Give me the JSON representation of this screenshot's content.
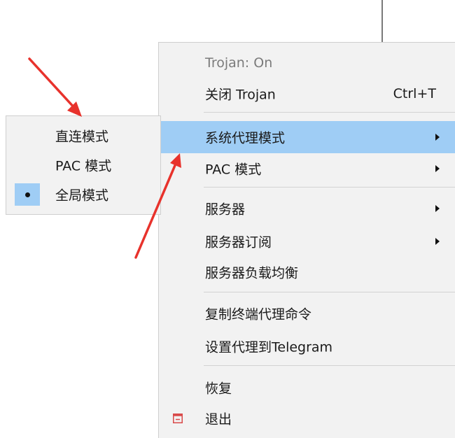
{
  "colors": {
    "menu_background": "#f2f2f2",
    "highlight": "#9fcdf5",
    "disabled_text": "#7b7b7b",
    "annotation_arrow": "#e8322c",
    "exit_icon": "#d94b4b"
  },
  "menu": {
    "status_label": "Trojan: On",
    "close_label": "关闭 Trojan",
    "close_shortcut": "Ctrl+T",
    "system_proxy_label": "系统代理模式",
    "pac_label": "PAC 模式",
    "servers_label": "服务器",
    "subscription_label": "服务器订阅",
    "load_balance_label": "服务器负载均衡",
    "copy_command_label": "复制终端代理命令",
    "telegram_label": "设置代理到Telegram",
    "restore_label": "恢复",
    "exit_label": "退出",
    "exit_icon": "window-minimize-icon",
    "submenu_arrow_icon": "chevron-right-icon"
  },
  "submenu": {
    "items": [
      {
        "label": "直连模式",
        "checked": false
      },
      {
        "label": "PAC 模式",
        "checked": false
      },
      {
        "label": "全局模式",
        "checked": true
      }
    ],
    "selected_icon": "radio-dot-icon"
  }
}
